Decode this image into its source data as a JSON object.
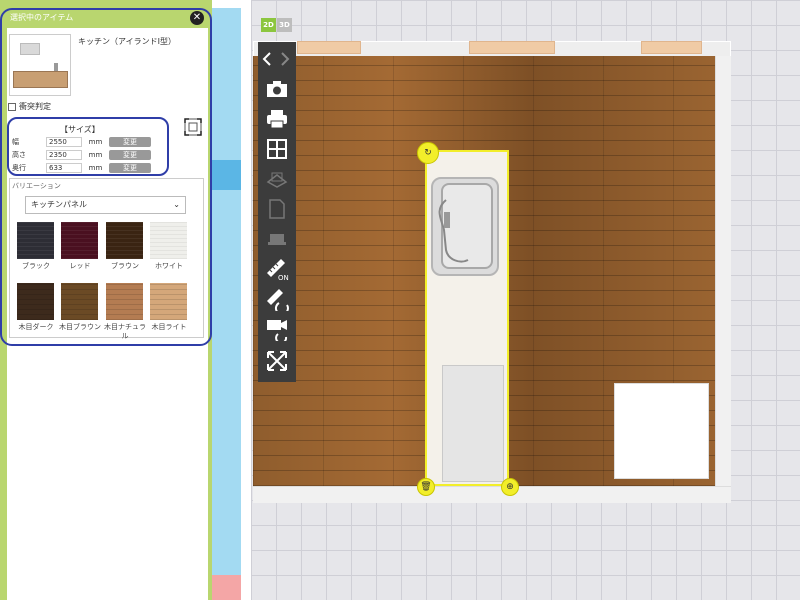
{
  "panel": {
    "header": "選択中のアイテム",
    "item_name": "キッチン（アイランドI型）",
    "collision_label": "衝突判定"
  },
  "size": {
    "title": "【サイズ】",
    "rows": [
      {
        "label": "幅",
        "value": "2550",
        "unit": "mm",
        "button": "変更"
      },
      {
        "label": "高さ",
        "value": "2350",
        "unit": "mm",
        "button": "変更"
      },
      {
        "label": "奥行",
        "value": "633",
        "unit": "mm",
        "button": "変更"
      }
    ]
  },
  "variation": {
    "title": "バリエーション",
    "selected": "キッチンパネル",
    "swatches": [
      {
        "label": "ブラック",
        "color": "#2d2d35"
      },
      {
        "label": "レッド",
        "color": "#4a1020"
      },
      {
        "label": "ブラウン",
        "color": "#3a2412"
      },
      {
        "label": "ホワイト",
        "color": "#efefeb"
      },
      {
        "label": "木目ダーク",
        "color": "#3d2a1c"
      },
      {
        "label": "木目ブラウン",
        "color": "#6b4a25"
      },
      {
        "label": "木目ナチュラ\nル",
        "color": "#b47c52"
      },
      {
        "label": "木目ライト",
        "color": "#d4a77a"
      }
    ]
  },
  "view_modes": {
    "mode_2d": "2D",
    "mode_3d": "3D"
  },
  "toolbar": {
    "icons": [
      "nav-arrows-icon",
      "camera-icon",
      "print-icon",
      "grid-icon",
      "3d-view-icon",
      "document-icon",
      "furniture-icon",
      "measure-on-icon",
      "measure-rotate-icon",
      "camera-rotate-icon",
      "fit-screen-icon"
    ]
  },
  "colors": {
    "accent_green": "#b9d66f",
    "selection_yellow": "#f2ee2a",
    "highlight_blue": "#2f3ea8"
  }
}
